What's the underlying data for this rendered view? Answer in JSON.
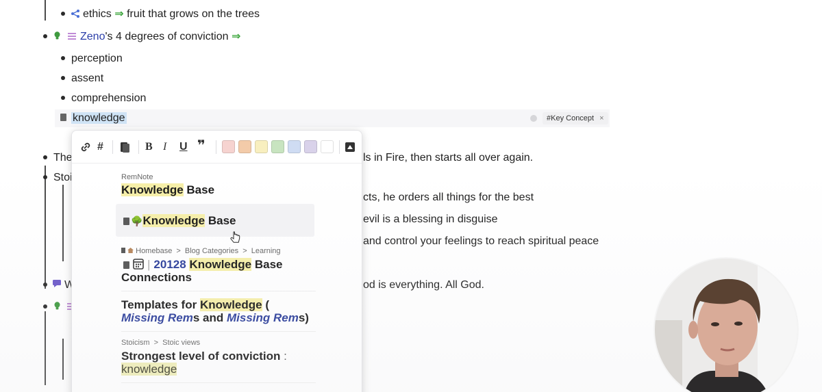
{
  "outline": {
    "ethics_line": {
      "left": "ethics",
      "arrow": "⇒",
      "right": "fruit that grows on the trees"
    },
    "zeno_line": {
      "ref": "Zeno",
      "rest": "'s 4 degrees of conviction",
      "arrow": "⇒"
    },
    "children": [
      "perception",
      "assent",
      "comprehension",
      "knowledge"
    ],
    "tag": {
      "label": "#Key Concept",
      "close": "×"
    },
    "partial_lines": [
      {
        "start": "The",
        "end": "ls in Fire, then starts all over again."
      },
      {
        "start": "Stoi",
        "end": ""
      },
      {
        "start": "",
        "end": "cts, he orders all things for the best"
      },
      {
        "start": "",
        "end": "evil is a blessing in disguise"
      },
      {
        "start": "",
        "end": "and control your feelings to reach spiritual peace"
      },
      {
        "start": "W",
        "end": "od is everything. All God."
      }
    ]
  },
  "popup": {
    "toolbar": {
      "link": "🔗",
      "hash": "#",
      "bold": "B",
      "italic": "I",
      "underline": "U",
      "quote": "❞",
      "collapse": "▲"
    },
    "swatches": [
      "#f6d3d0",
      "#f3cba9",
      "#f8efbf",
      "#c8e4c0",
      "#cfdcf3",
      "#d9d2ea",
      "#ffffff"
    ],
    "results": [
      {
        "crumb": "RemNote",
        "hl": "Knowledge",
        "rest": " Base"
      },
      {
        "emoji": "🌳",
        "hl": "Knowledge",
        "rest": " Base"
      },
      {
        "crumb_a": "Homebase",
        "sep1": ">",
        "crumb_b": "Blog Categories",
        "sep2": ">",
        "crumb_c": "Learning",
        "pipe": "|",
        "num": "20128",
        "hl": "Knowledge",
        "rest": " Base",
        "line2": "Connections"
      },
      {
        "pre": "Templates for ",
        "hl": "Knowledge",
        "post": " (",
        "ref1": "Missing Rem",
        "mid": "s and ",
        "ref2": "Missing Rem",
        "end": "s)"
      },
      {
        "crumb_a": "Stoicism",
        "sep": ">",
        "crumb_b": "Stoic views",
        "title": "Strongest level of conviction",
        "colon": " :",
        "hl": "knowledge"
      }
    ]
  },
  "colors": {
    "accent": "#2b3ea8",
    "arrow": "#3aa43a",
    "highlight": "#f6efa8",
    "selection": "#cfe3f5"
  }
}
